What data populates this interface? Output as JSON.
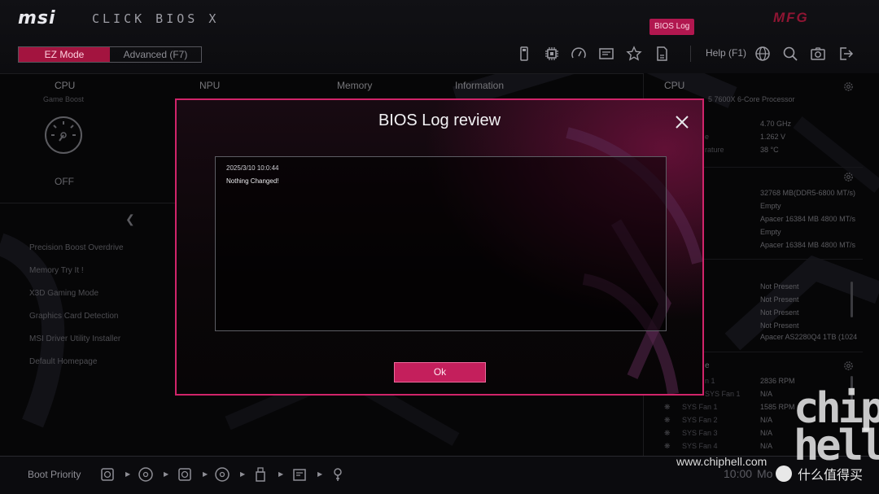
{
  "header": {
    "brand": "msi",
    "app_title": "CLICK BIOS X",
    "bios_log_button": "BIOS Log",
    "board_brand": "MFG",
    "modes": [
      {
        "label": "EZ Mode",
        "active": true
      },
      {
        "label": "Advanced (F7)",
        "active": false
      }
    ],
    "help_label": "Help (F1)",
    "toolbar_icons": [
      "usb-flash-icon",
      "cpu-chip-icon",
      "speedometer-icon",
      "hardware-monitor-icon",
      "favorites-star-icon",
      "memory-sd-icon"
    ],
    "right_icons": [
      "globe-icon",
      "search-icon",
      "camera-icon",
      "exit-icon"
    ]
  },
  "overview": {
    "cpu_title": "CPU",
    "cpu_sub": "Game Boost",
    "game_boost_state": "OFF",
    "npu_title": "NPU",
    "memory_title": "Memory",
    "information_title": "Information"
  },
  "left_menu": [
    "Precision Boost Overdrive",
    "Memory Try It !",
    "X3D Gaming Mode",
    "Graphics Card Detection",
    "MSI Driver Utility Installer",
    "Default Homepage"
  ],
  "right_panel": {
    "cpu_title": "CPU",
    "cpu_name": "5 7600X 6-Core Processor",
    "cpu_values": [
      "4.70 GHz",
      "1.262 V",
      "38 °C"
    ],
    "cpu_labels": [
      "",
      "e",
      "rature"
    ],
    "memory_values": [
      "32768 MB(DDR5-6800 MT/s)",
      "Empty",
      "Apacer 16384 MB 4800 MT/s",
      "Empty",
      "Apacer 16384 MB 4800 MT/s"
    ],
    "storage_values": [
      "Not Present",
      "Not Present",
      "Not Present",
      "Not Present",
      "Apacer AS2280Q4 1TB (1024"
    ],
    "fan_section_suffix": "e",
    "fans": [
      {
        "label": "n 1",
        "value": "2836 RPM"
      },
      {
        "label": "SYS Fan 1",
        "value": "N/A"
      },
      {
        "label": "SYS Fan 1",
        "value": "1585 RPM"
      },
      {
        "label": "SYS Fan 2",
        "value": "N/A"
      },
      {
        "label": "SYS Fan 3",
        "value": "N/A"
      },
      {
        "label": "SYS Fan 4",
        "value": "N/A"
      }
    ]
  },
  "bottom": {
    "boot_priority_label": "Boot Priority",
    "time": "10:00",
    "date_partial": "Mo",
    "boot_devices": [
      "hdd-icon",
      "optical-disc-icon",
      "hdd-icon",
      "optical-disc-icon",
      "usb-icon",
      "usb-drive-icon",
      "usb-key-icon"
    ]
  },
  "modal": {
    "title": "BIOS Log review",
    "log_timestamp": "2025/3/10 10:0:44",
    "log_message": "Nothing Changed!",
    "ok_label": "Ok"
  },
  "watermark": {
    "url": "www.chiphell.com",
    "brand": "什么值得买",
    "logo_line1": "chip",
    "logo_line2": "hell"
  },
  "colors": {
    "accent": "#c41f5c",
    "modal_border": "#d0246a",
    "active_tab": "#a3143f"
  }
}
